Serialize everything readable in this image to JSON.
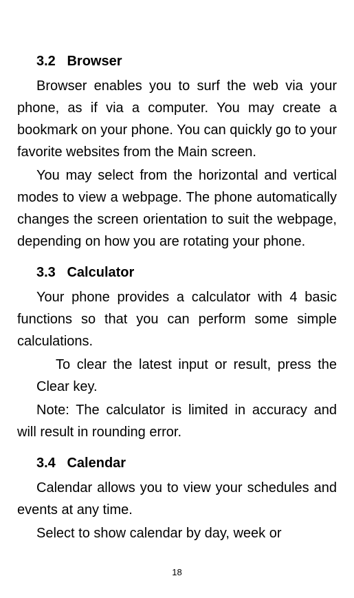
{
  "sections": [
    {
      "number": "3.2",
      "title": "Browser",
      "paragraphs": [
        "Browser enables you to surf the web via your phone, as if via a computer. You may create a bookmark on your phone. You can quickly go to your favorite websites from the Main screen.",
        "You may select from the horizontal and vertical modes to view a webpage. The phone automatically changes the screen orientation to suit the webpage, depending on how you are rotating your phone."
      ]
    },
    {
      "number": "3.3",
      "title": "Calculator",
      "paragraphs": [
        "Your phone provides a calculator with 4 basic functions so that you can perform some simple calculations."
      ],
      "indented": [
        "To clear the latest input or result, press the Clear key."
      ],
      "afterIndented": [
        "Note: The calculator is limited in accuracy and will result in rounding error."
      ]
    },
    {
      "number": "3.4",
      "title": "Calendar",
      "paragraphs": [
        "Calendar allows you to view your schedules and events at any time.",
        "Select to show calendar by day, week or"
      ]
    }
  ],
  "pageNumber": "18"
}
